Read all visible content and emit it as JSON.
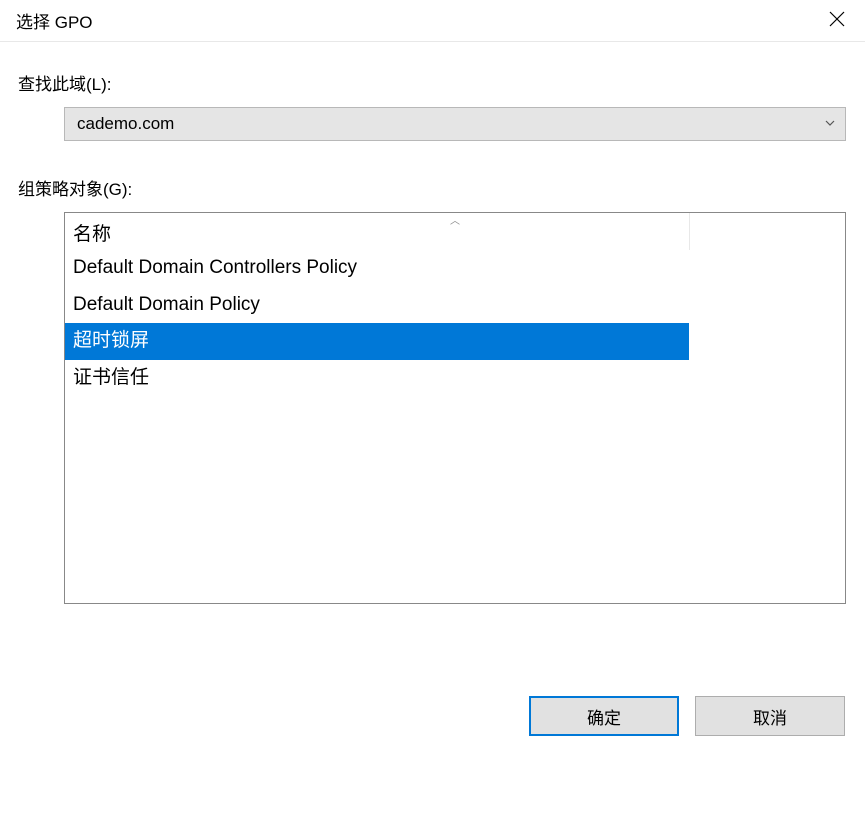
{
  "titlebar": {
    "title": "选择 GPO"
  },
  "domain_field": {
    "label": "查找此域(L):",
    "value": "cademo.com"
  },
  "gpo_field": {
    "label": "组策略对象(G):",
    "column_header": "名称",
    "items": [
      {
        "label": "Default Domain Controllers Policy",
        "selected": false
      },
      {
        "label": "Default Domain Policy",
        "selected": false
      },
      {
        "label": "超时锁屏",
        "selected": true
      },
      {
        "label": "证书信任",
        "selected": false
      }
    ]
  },
  "buttons": {
    "ok": "确定",
    "cancel": "取消"
  }
}
